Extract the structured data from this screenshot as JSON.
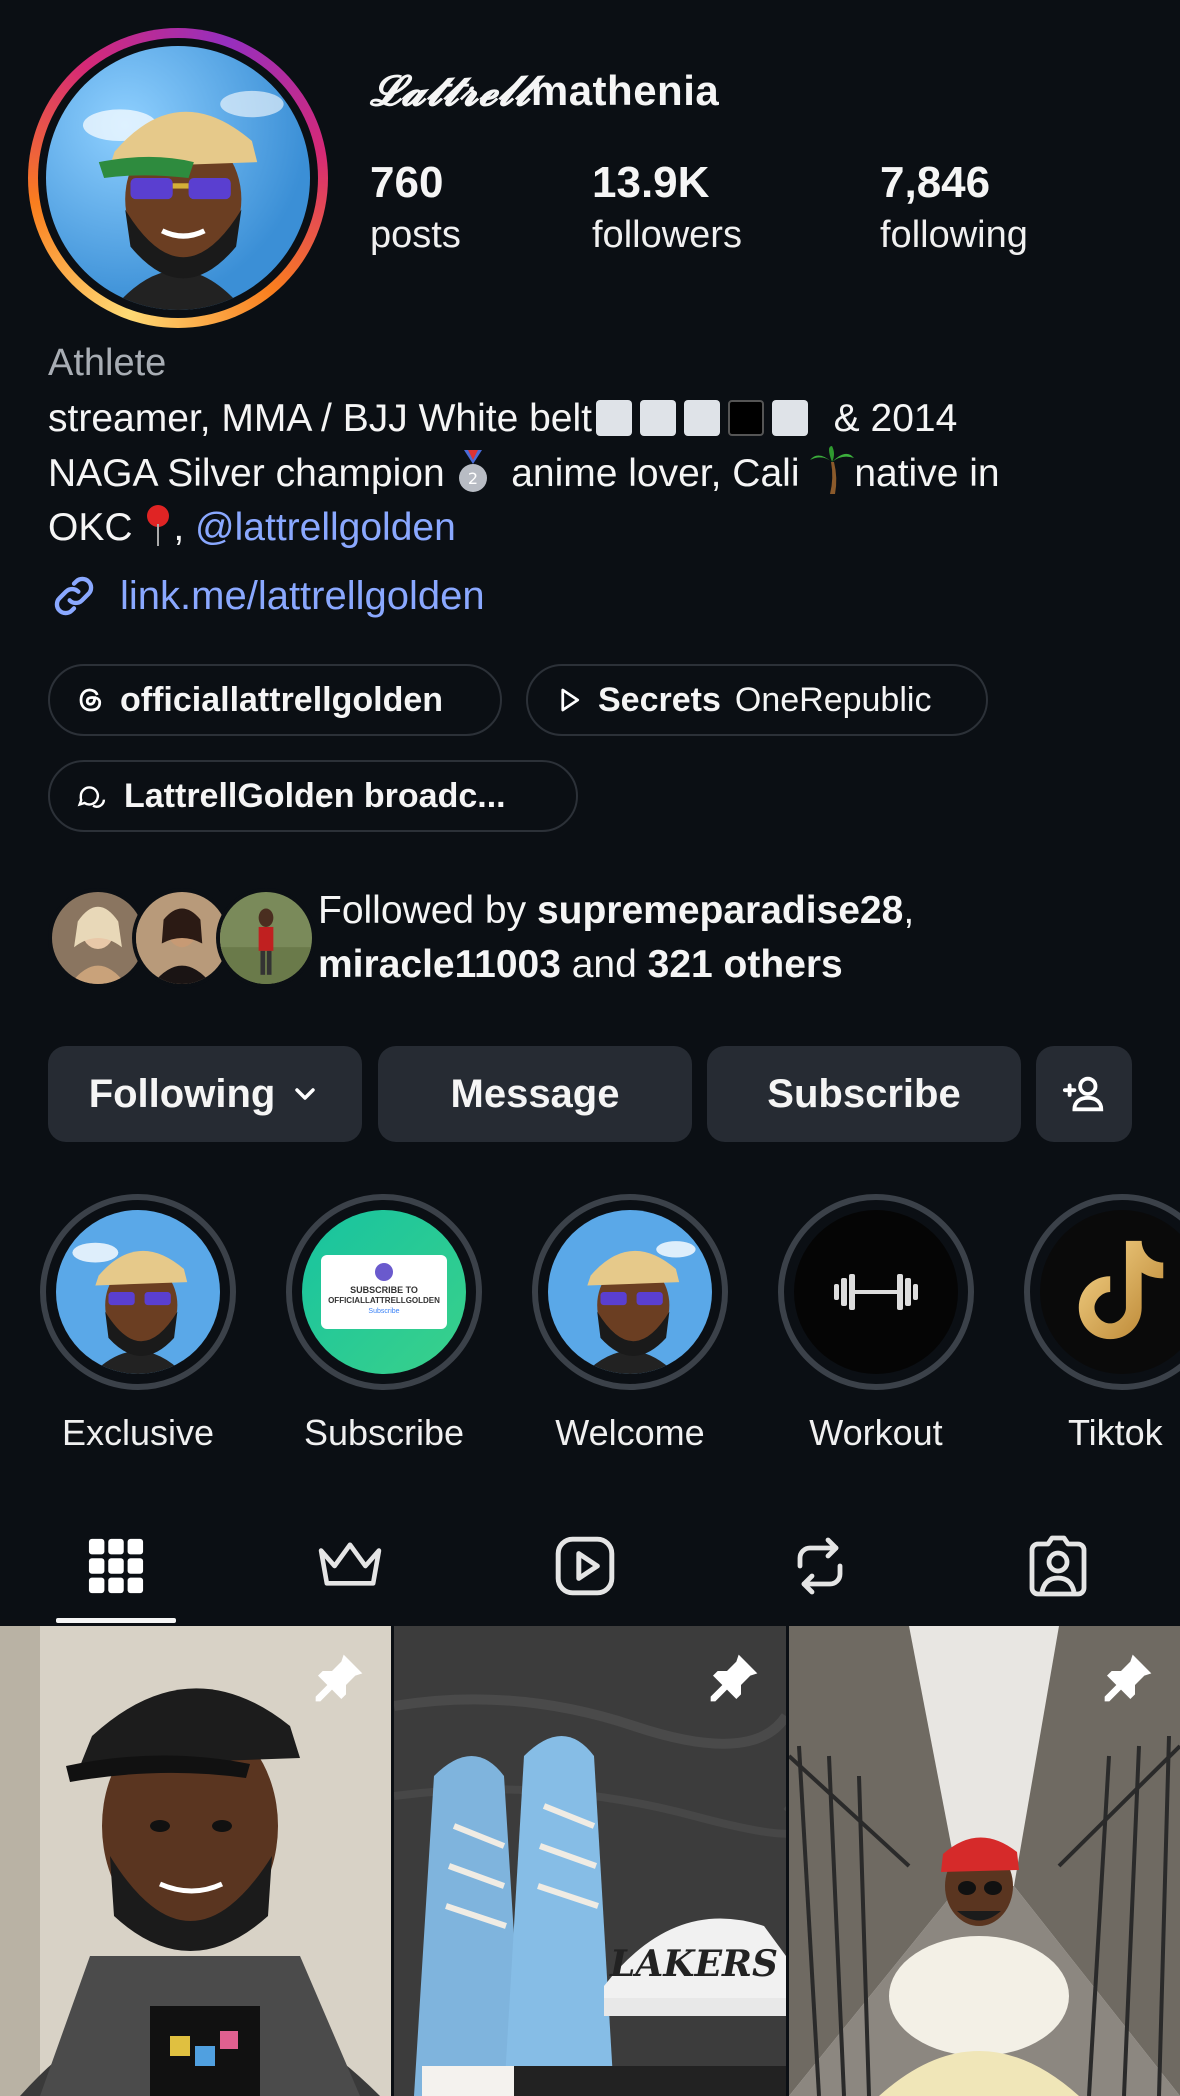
{
  "profile": {
    "username_fancy": "𝓛𝓪𝓽𝓽𝓻𝓮𝓵𝓵",
    "username_rest": "mathenia",
    "stats": [
      {
        "value": "760",
        "label": "posts"
      },
      {
        "value": "13.9K",
        "label": "followers"
      },
      {
        "value": "7,846",
        "label": "following"
      }
    ],
    "category": "Athlete",
    "bio_line1_a": "streamer, MMA / BJJ White belt",
    "bio_line1_b": "& 2014",
    "bio_line2_a": "NAGA Silver champion",
    "bio_line2_b": "anime lover, Cali",
    "bio_line2_c": "native in",
    "bio_line3_a": "OKC",
    "bio_line3_b": ",",
    "bio_mention": "@lattrellgolden",
    "link": "link.me/lattrellgolden"
  },
  "chips": {
    "threads": "officiallattrellgolden",
    "music_title": "Secrets",
    "music_artist": "OneRepublic",
    "channel": "LattrellGolden broadc..."
  },
  "followed_by": {
    "prefix": "Followed by ",
    "user1": "supremeparadise28",
    "comma": ",",
    "user2": "miracle11003",
    "and": " and ",
    "others": "321 others"
  },
  "actions": {
    "following": "Following",
    "message": "Message",
    "subscribe": "Subscribe"
  },
  "highlights": [
    {
      "label": "Exclusive"
    },
    {
      "label": "Subscribe",
      "card_line1": "SUBSCRIBE TO",
      "card_line2": "OFFICIALLATTRELLGOLDEN",
      "card_btn": "Subscribe"
    },
    {
      "label": "Welcome"
    },
    {
      "label": "Workout"
    },
    {
      "label": "Tiktok"
    }
  ],
  "grid": {
    "tile2_cap_text": "LAKERS"
  },
  "colors": {
    "background": "#0b0f14",
    "link": "#8aa8ff",
    "button": "#262b33"
  }
}
